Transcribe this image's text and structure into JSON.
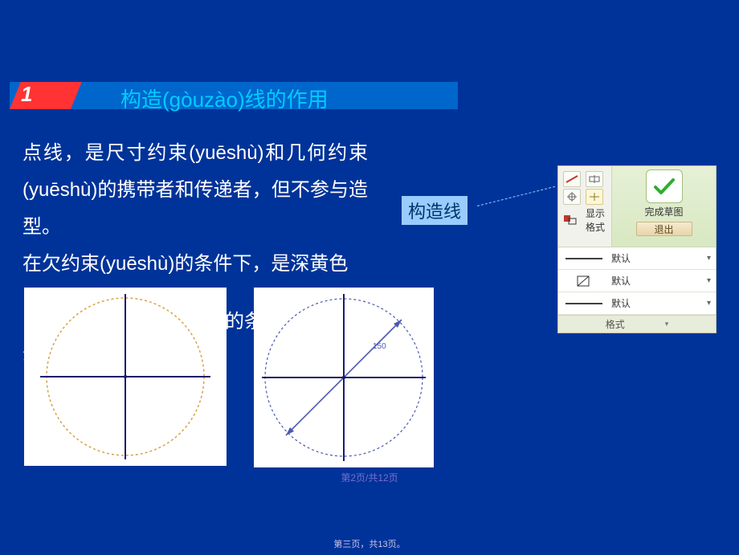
{
  "section": {
    "number": "1",
    "title": "构造(gòuzào)线的作用"
  },
  "body": {
    "p1": "点线，是尺寸约束(yuēshù)和几何约束(yuēshù)的携带者和传递者，但不参与造型。",
    "p2": "在欠约束(yuēshù)的条件下，是深黄色",
    "p3": "的条",
    "p4": "动"
  },
  "label": {
    "gouzaoxian": "构造线"
  },
  "fig_b": {
    "dim": "150"
  },
  "panel": {
    "show_format": "显示格式",
    "finish": "完成草图",
    "exit": "退出",
    "row1": "默认",
    "row2": "默认",
    "row3": "默认",
    "footer": "格式"
  },
  "pagenote1": "第2页/共12页",
  "pagenote2": "第三页，共13页。"
}
